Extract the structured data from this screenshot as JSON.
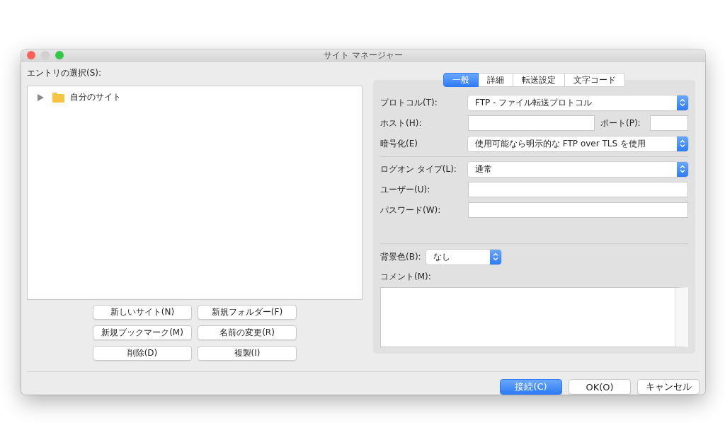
{
  "window": {
    "title": "サイト マネージャー"
  },
  "entry_label": "エントリの選択(S):",
  "tree": [
    {
      "label": "自分のサイト",
      "expanded": false
    }
  ],
  "tree_buttons": [
    "新しいサイト(N)",
    "新規フォルダー(F)",
    "新規ブックマーク(M)",
    "名前の変更(R)",
    "削除(D)",
    "複製(I)"
  ],
  "tabs": [
    {
      "label": "一般",
      "selected": true
    },
    {
      "label": "詳細",
      "selected": false
    },
    {
      "label": "転送設定",
      "selected": false
    },
    {
      "label": "文字コード",
      "selected": false
    }
  ],
  "protocol": {
    "label": "プロトコル(T):",
    "value": "FTP - ファイル転送プロトコル"
  },
  "host": {
    "label": "ホスト(H):"
  },
  "port": {
    "label": "ポート(P):"
  },
  "encryption": {
    "label": "暗号化(E)",
    "value": "使用可能なら明示的な FTP over TLS を使用"
  },
  "logon_type": {
    "label": "ログオン タイプ(L):",
    "value": "通常"
  },
  "user": {
    "label": "ユーザー(U):"
  },
  "password": {
    "label": "パスワード(W):"
  },
  "background_color": {
    "label": "背景色(B):",
    "value": "なし"
  },
  "comment": {
    "label": "コメント(M):"
  },
  "buttons": [
    {
      "label": "接続(C)",
      "default": true
    },
    {
      "label": "OK(O)",
      "default": false
    },
    {
      "label": "キャンセル",
      "default": false
    }
  ]
}
